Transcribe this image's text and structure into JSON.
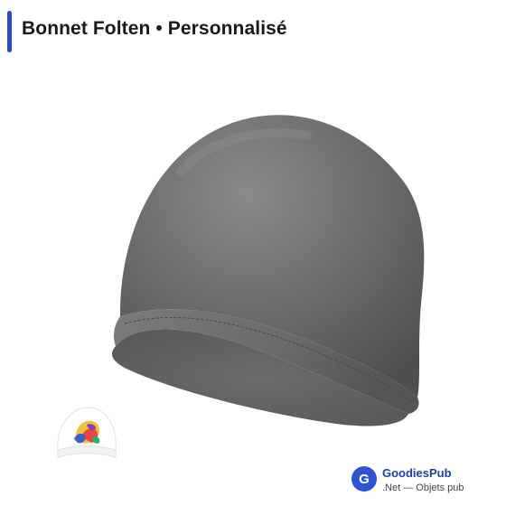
{
  "header": {
    "title": "Bonnet Folten • Personnalisé"
  },
  "product": {
    "image_icon": "beanie-hat-image",
    "color": "#6e6e70"
  },
  "thumbnail": {
    "icon": "beanie-thumbnail-with-logo"
  },
  "brand": {
    "logo_letter": "G",
    "name": "GoodiesPub",
    "tagline": ".Net — Objets pub"
  },
  "colors": {
    "accent": "#2b4bc4",
    "brand_logo": "#2d54d6"
  }
}
